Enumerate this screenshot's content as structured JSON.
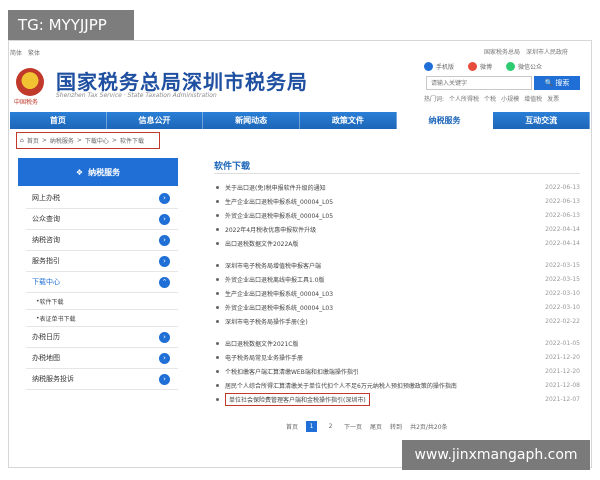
{
  "watermark": {
    "tag": "TG: MYYJJPP",
    "url": "www.jinxmangaph.com"
  },
  "top_links": [
    "简体",
    "繁体"
  ],
  "top_links_right": [
    "国家税务总局",
    "深圳市人民政府"
  ],
  "header": {
    "emblem_caption": "中国税务",
    "title": "国家税务总局深圳市税务局",
    "subtitle": "Shenzhen Tax Service · State Taxation Administration"
  },
  "share": [
    {
      "label": "手机版",
      "color": "#1f6fd6"
    },
    {
      "label": "微博",
      "color": "#e74c3c"
    },
    {
      "label": "微信公众",
      "color": "#2ecc71"
    }
  ],
  "search": {
    "placeholder": "请输入关键字",
    "button_label": "搜索"
  },
  "hot_words": [
    "热门词:",
    "个人所得税",
    "个税",
    "小规模",
    "增值税",
    "发票"
  ],
  "nav": [
    "首页",
    "信息公开",
    "新闻动态",
    "政策文件",
    "纳税服务",
    "互动交流"
  ],
  "nav_active": 4,
  "breadcrumb": [
    "首页",
    "纳税服务",
    "下载中心",
    "软件下载"
  ],
  "sidebar": {
    "header": "纳税服务",
    "items": [
      {
        "label": "网上办税",
        "type": "main"
      },
      {
        "label": "公众查询",
        "type": "main"
      },
      {
        "label": "纳税咨询",
        "type": "main"
      },
      {
        "label": "服务指引",
        "type": "main"
      },
      {
        "label": "下载中心",
        "type": "main",
        "open": true
      },
      {
        "label": "软件下载",
        "type": "sub"
      },
      {
        "label": "表证单书下载",
        "type": "sub"
      },
      {
        "label": "办税日历",
        "type": "main"
      },
      {
        "label": "办税地图",
        "type": "main"
      },
      {
        "label": "纳税服务投诉",
        "type": "main"
      }
    ]
  },
  "content": {
    "title": "软件下载",
    "groups": [
      [
        {
          "title": "关于出口退(免)税申报软件升级的通知",
          "date": "2022-06-13"
        },
        {
          "title": "生产企业出口退税申报系统_00004_L05",
          "date": "2022-06-13"
        },
        {
          "title": "外贸企业出口退税申报系统_00004_L05",
          "date": "2022-06-13"
        },
        {
          "title": "2022年4月税收优惠申报软件升级",
          "date": "2022-04-14"
        },
        {
          "title": "出口退税数据文件2022A版",
          "date": "2022-04-14"
        }
      ],
      [
        {
          "title": "深圳市电子税务局增值税申报客户端",
          "date": "2022-03-15"
        },
        {
          "title": "外贸企业出口退税离线申报工具1.0版",
          "date": "2022-03-15"
        },
        {
          "title": "生产企业出口退税申报系统_00004_L03",
          "date": "2022-03-10"
        },
        {
          "title": "外贸企业出口退税申报系统_00004_L03",
          "date": "2022-03-10"
        },
        {
          "title": "深圳市电子税务局操作手册(全)",
          "date": "2022-02-22"
        }
      ],
      [
        {
          "title": "出口退税数据文件2021C版",
          "date": "2022-01-05"
        },
        {
          "title": "电子税务局常见业务操作手册",
          "date": "2021-12-20"
        },
        {
          "title": "个税扣缴客户端汇算清缴WEB端和扣缴端操作指引",
          "date": "2021-12-20"
        },
        {
          "title": "居民个人综合所得汇算清缴关于单位代扣个人不足6万元纳税人预扣预缴政策的操作指南",
          "date": "2021-12-08"
        },
        {
          "title": "单位社会保险费管理客户端和金税操作指引(深圳市)",
          "date": "2021-12-07",
          "highlighted": true
        }
      ]
    ]
  },
  "pager": {
    "first": "首页",
    "pages": [
      "1",
      "2"
    ],
    "current": 0,
    "next": "下一页",
    "last": "尾页",
    "summary_left": "转到",
    "summary": "共2页/共20条"
  }
}
